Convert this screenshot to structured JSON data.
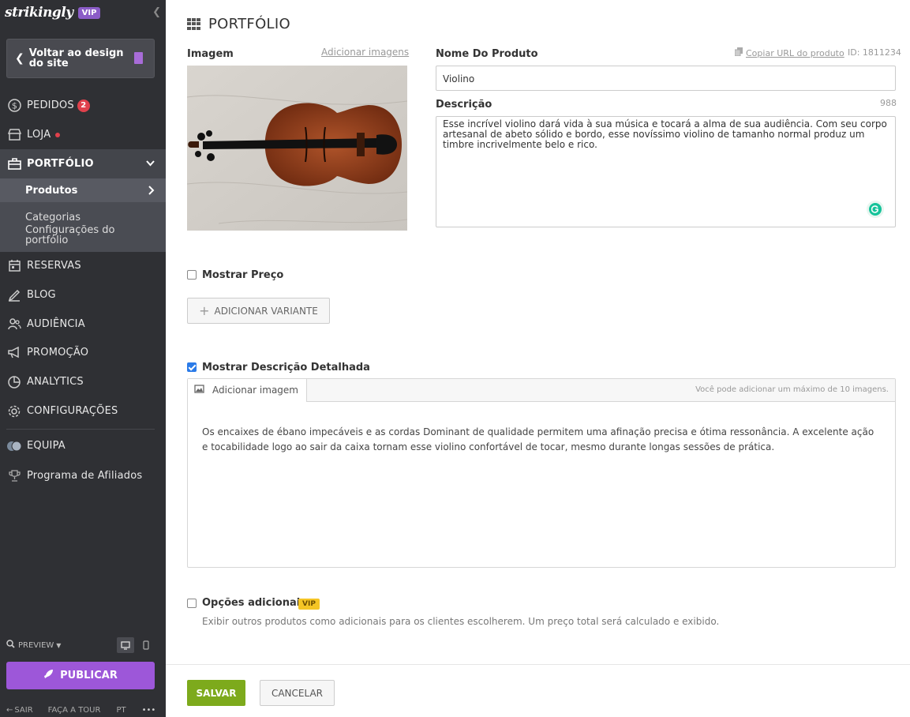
{
  "sidebar": {
    "logo": "strikingly",
    "vip": "VIP",
    "back_label": "Voltar ao design do site",
    "nav": {
      "pedidos": "PEDIDOS",
      "pedidos_count": "2",
      "loja": "LOJA",
      "portfolio": "PORTFÓLIO",
      "reservas": "RESERVAS",
      "blog": "BLOG",
      "audiencia": "AUDIÊNCIA",
      "promocao": "PROMOÇÃO",
      "analytics": "ANALYTICS",
      "configuracoes": "CONFIGURAÇÕES",
      "equipa": "EQUIPA",
      "afiliados": "Programa de Afiliados"
    },
    "sub": {
      "produtos": "Produtos",
      "categorias": "Categorias",
      "config_portfolio": "Configurações do portfólio"
    },
    "preview": "PREVIEW",
    "publish": "PUBLICAR",
    "footer": {
      "sair": "SAIR",
      "tour": "FAÇA A TOUR",
      "lang": "PT",
      "more": "•••"
    }
  },
  "main": {
    "title": "PORTFÓLIO",
    "image_label": "Imagem",
    "add_images": "Adicionar imagens",
    "product_name_label": "Nome Do Produto",
    "copy_url": "Copiar URL do produto",
    "id_text": "ID: 1811234",
    "product_name_value": "Violino",
    "description_label": "Descrição",
    "description_count": "988",
    "description_value": "Esse incrível violino dará vida à sua música e tocará a alma de sua audiência. Com seu corpo artesanal de abeto sólido e bordo, esse novíssimo violino de tamanho normal produz um timbre incrivelmente belo e rico.",
    "show_price": "Mostrar Preço",
    "add_variant": "ADICIONAR VARIANTE",
    "show_detailed": "Mostrar Descrição Detalhada",
    "add_image": "Adicionar imagem",
    "max_images": "Você pode adicionar um máximo de 10 imagens.",
    "detailed_text": "Os encaixes de ébano impecáveis e as cordas Dominant de qualidade permitem uma afinação precisa e ótima ressonância. A excelente ação e tocabilidade logo ao sair da caixa tornam esse violino confortável de tocar, mesmo durante longas sessões de prática.",
    "extra_options": "Opções adicionais",
    "extra_vip": "VIP",
    "extra_desc": "Exibir outros produtos como adicionais para os clientes escolherem. Um preço total será calculado e exibido.",
    "save": "SALVAR",
    "cancel": "CANCELAR"
  },
  "colors": {
    "sidebar_bg": "#2f3034",
    "accent_purple": "#9d57d9",
    "save_green": "#7daa1c",
    "check_blue": "#2b7be8"
  }
}
